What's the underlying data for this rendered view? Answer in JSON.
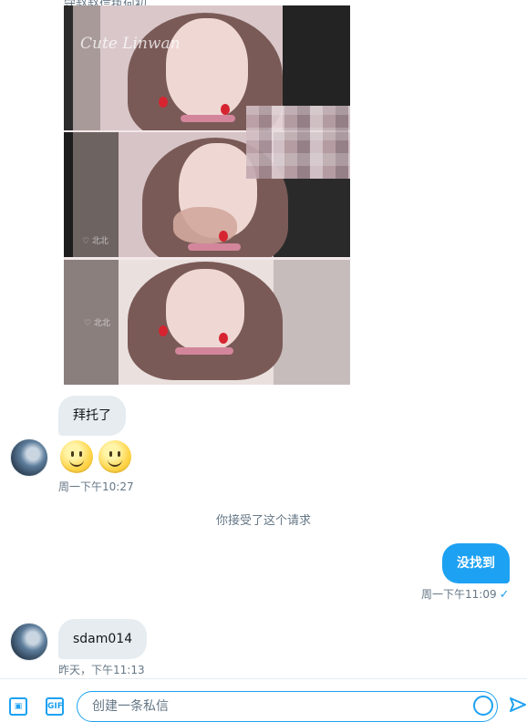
{
  "thread": {
    "cut_text": "守赵赵信执何初。",
    "media": {
      "watermark": "Cute Linwan",
      "small_mark": "♡ 北北",
      "blurred": true
    },
    "messages": [
      {
        "direction": "in",
        "text": "拜托了"
      },
      {
        "direction": "in",
        "emoji": [
          "slightly-smiling-face",
          "slightly-smiling-face"
        ],
        "time": "周一下午10:27"
      },
      {
        "direction": "system",
        "text": "你接受了这个请求"
      },
      {
        "direction": "out",
        "text": "没找到",
        "time": "周一下午11:09",
        "status": "✓"
      },
      {
        "direction": "in",
        "text": "sdam014",
        "time": "昨天，下午11:13"
      }
    ]
  },
  "composer": {
    "placeholder": "创建一条私信",
    "icons": [
      "image-icon",
      "gif-icon",
      "emoji-icon",
      "send-icon"
    ],
    "gif_label": "GIF"
  },
  "colors": {
    "accent": "#1da1f2",
    "bubble_in": "#e6ecf0",
    "meta_text": "#657786"
  }
}
